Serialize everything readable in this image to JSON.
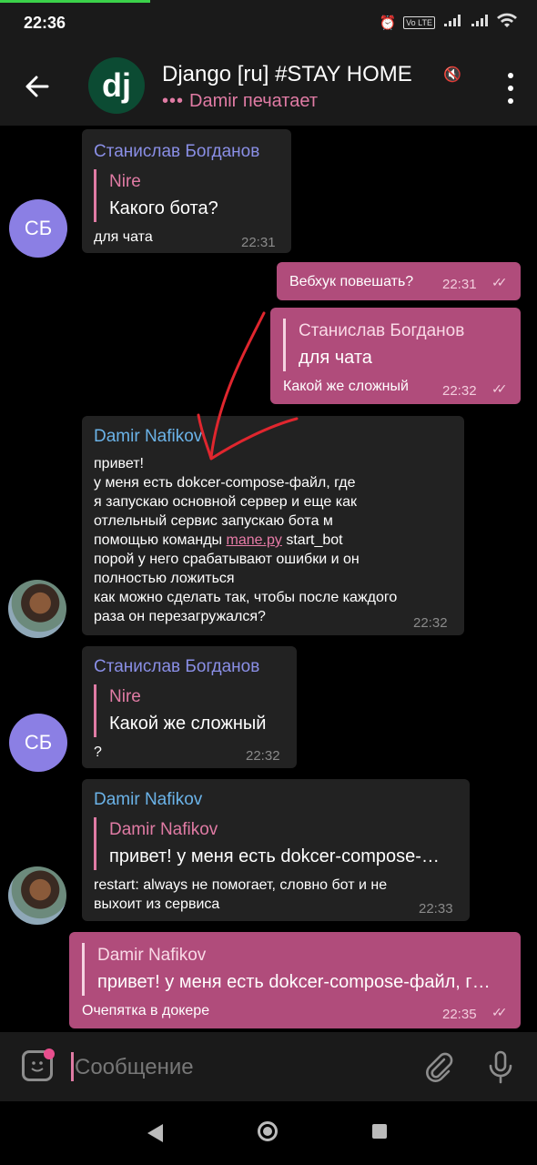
{
  "status_bar": {
    "time": "22:36",
    "icons": [
      "alarm-off-icon",
      "volte-icon",
      "signal-icon",
      "signal-icon",
      "wifi-icon"
    ],
    "lte_label": "Vo LTE"
  },
  "header": {
    "title": "Django [ru] #STAY HOME",
    "avatar_text": "dj",
    "typing_status": "Damir печатает",
    "avatar_color": "#0c4b33",
    "accent_color": "#e07ba4"
  },
  "messages": [
    {
      "direction": "in",
      "sender": "Станислав Богданов",
      "reply_to_name": "Nire",
      "reply_to_text": "Какого бота?",
      "text": "для чата",
      "time": "22:31",
      "avatar_initials": "СБ"
    },
    {
      "direction": "out",
      "text": "Вебхук повешать?",
      "time": "22:31",
      "read": true
    },
    {
      "direction": "out",
      "reply_to_name": "Станислав Богданов",
      "reply_to_text": "для чата",
      "text": "Какой же сложный",
      "time": "22:32",
      "read": true
    },
    {
      "direction": "in",
      "sender": "Damir Nafikov",
      "text_lines": [
        "привет!",
        "у меня есть dokcer-compose-файл, где",
        "я запускаю основной сервер и еще как",
        "отлельный сервис запускаю бота м",
        "помощью команды",
        "mane.py",
        "start_bot",
        "порой у него срабатывают ошибки и он",
        "полностью ложиться",
        "как можно сделать так, чтобы после каждого",
        "раза он перезагружался?"
      ],
      "time": "22:32"
    },
    {
      "direction": "in",
      "sender": "Станислав Богданов",
      "reply_to_name": "Nire",
      "reply_to_text": "Какой же сложный",
      "text": "?",
      "time": "22:32",
      "avatar_initials": "СБ"
    },
    {
      "direction": "in",
      "sender": "Damir Nafikov",
      "reply_to_name": "Damir Nafikov",
      "reply_to_text": "привет! у меня есть dokcer-compose-…",
      "text_lines": [
        "restart: always не помогает, словно бот и не",
        "выхоит из сервиса"
      ],
      "time": "22:33"
    },
    {
      "direction": "out",
      "reply_to_name": "Damir Nafikov",
      "reply_to_text": "привет! у меня есть dokcer-compose-файл, г…",
      "text": "Очепятка в докере",
      "time": "22:35",
      "read": true
    }
  ],
  "composer": {
    "placeholder": "Сообщение"
  },
  "colors": {
    "incoming_bubble": "#222222",
    "outgoing_bubble": "#b04c7b",
    "sender_purple": "#8a8fe6",
    "sender_blue": "#6bb3e8",
    "annotation_red": "#e0262e"
  }
}
